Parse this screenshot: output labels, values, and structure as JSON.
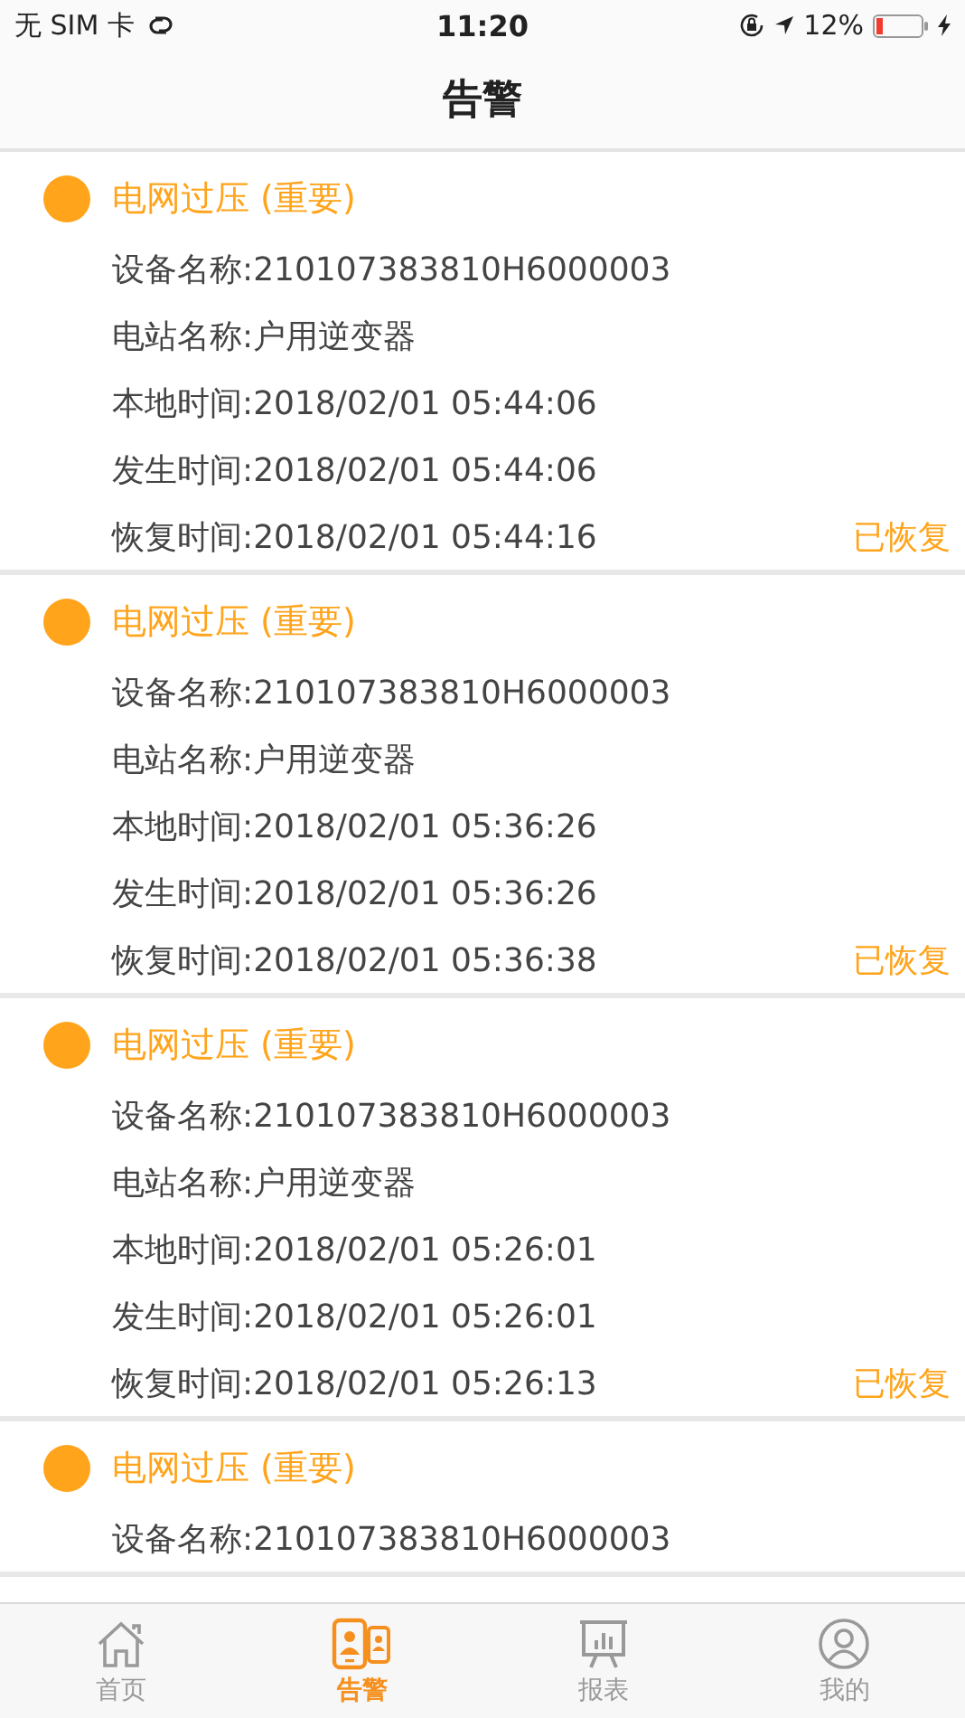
{
  "status_bar": {
    "carrier": "无 SIM 卡",
    "time": "11:20",
    "battery": "12%"
  },
  "nav": {
    "title": "告警"
  },
  "alarms": [
    {
      "title": "电网过压 (重要)",
      "rows": [
        "设备名称:210107383810H6000003",
        "电站名称:户用逆变器",
        "本地时间:2018/02/01 05:44:06",
        "发生时间:2018/02/01 05:44:06",
        "恢复时间:2018/02/01 05:44:16"
      ],
      "status": "已恢复"
    },
    {
      "title": "电网过压 (重要)",
      "rows": [
        "设备名称:210107383810H6000003",
        "电站名称:户用逆变器",
        "本地时间:2018/02/01 05:36:26",
        "发生时间:2018/02/01 05:36:26",
        "恢复时间:2018/02/01 05:36:38"
      ],
      "status": "已恢复"
    },
    {
      "title": "电网过压 (重要)",
      "rows": [
        "设备名称:210107383810H6000003",
        "电站名称:户用逆变器",
        "本地时间:2018/02/01 05:26:01",
        "发生时间:2018/02/01 05:26:01",
        "恢复时间:2018/02/01 05:26:13"
      ],
      "status": "已恢复"
    },
    {
      "title": "电网过压 (重要)",
      "rows": [
        "设备名称:210107383810H6000003"
      ]
    }
  ],
  "tabs": [
    {
      "label": "首页",
      "kind": "home",
      "selected": false
    },
    {
      "label": "告警",
      "kind": "alarm",
      "selected": true
    },
    {
      "label": "报表",
      "kind": "report",
      "selected": false
    },
    {
      "label": "我的",
      "kind": "profile",
      "selected": false
    }
  ]
}
